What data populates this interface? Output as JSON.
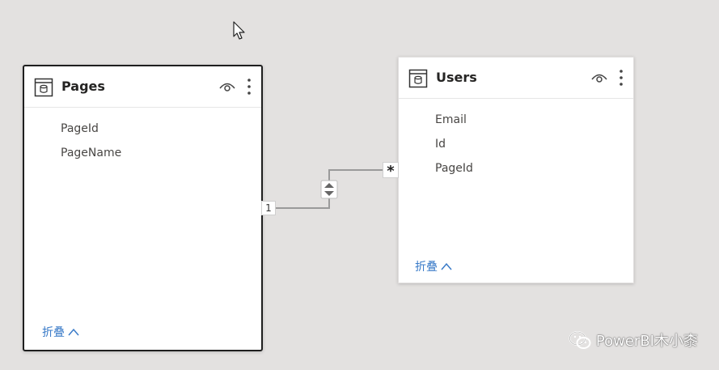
{
  "tables": {
    "pages": {
      "title": "Pages",
      "fields": [
        "PageId",
        "PageName"
      ],
      "collapse_label": "折叠"
    },
    "users": {
      "title": "Users",
      "fields": [
        "Email",
        "Id",
        "PageId"
      ],
      "collapse_label": "折叠"
    }
  },
  "relationship": {
    "from_cardinality": "1",
    "to_cardinality": "*"
  },
  "watermark": {
    "text": "PowerBI木小桼"
  },
  "colors": {
    "canvas": "#e3e1e0",
    "link": "#3a7bc8",
    "line": "#9a9a9a"
  }
}
